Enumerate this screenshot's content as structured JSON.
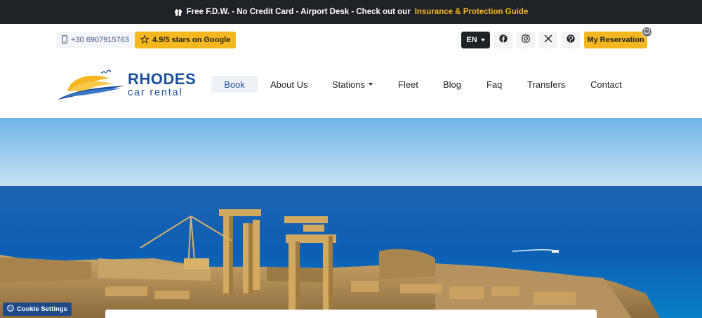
{
  "topbar": {
    "text": "Free F.D.W. - No Credit Card - Airport Desk - Check out our",
    "link": "Insurance & Protection Guide"
  },
  "utility": {
    "phone": "+30 6907915763",
    "stars": "4.9/5 stars on Google",
    "language": "EN",
    "reservation": "My Reservation"
  },
  "logo": {
    "title": "RHODES",
    "subtitle": "car rental"
  },
  "nav": {
    "book": "Book",
    "about": "About Us",
    "stations": "Stations",
    "fleet": "Fleet",
    "blog": "Blog",
    "faq": "Faq",
    "transfers": "Transfers",
    "contact": "Contact"
  },
  "cookie": {
    "label": "Cookie Settings"
  },
  "colors": {
    "accent": "#f5b71f",
    "brand": "#1e4f9a",
    "dark": "#1f2227"
  },
  "icons": [
    "gift-icon",
    "phone-icon",
    "star-icon",
    "facebook-icon",
    "instagram-icon",
    "x-icon",
    "pinterest-icon",
    "chat-icon",
    "cookie-icon"
  ]
}
